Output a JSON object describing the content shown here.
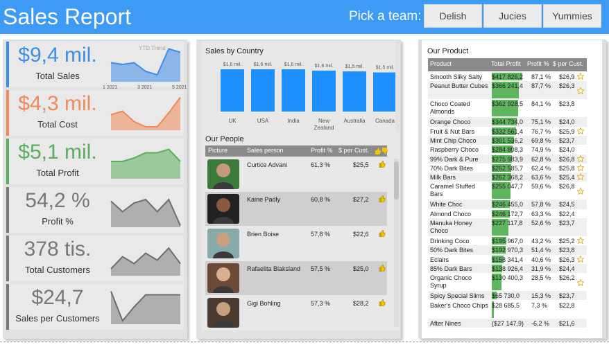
{
  "header": {
    "title": "Sales Report",
    "pick_label": "Pick a team:",
    "teams": [
      "Delish",
      "Jucies",
      "Yummies"
    ]
  },
  "kpis": [
    {
      "value": "$9,4 mil.",
      "label": "Total Sales",
      "color": "#3d8ee8",
      "trend_label": "YTD Trend",
      "axis": [
        "1 2021",
        "3 2021",
        "5 2021"
      ],
      "trend": [
        0.55,
        0.5,
        0.55,
        0.3,
        0.2,
        0.95,
        0.85
      ]
    },
    {
      "value": "$4,3 mil.",
      "label": "Total Cost",
      "color": "#ef8a5a",
      "trend": [
        0.45,
        0.55,
        0.25,
        0.1,
        0.1,
        0.5,
        0.95
      ]
    },
    {
      "value": "$5,1 mil.",
      "label": "Total Profit",
      "color": "#5cae5c",
      "trend": [
        0.5,
        0.5,
        0.6,
        0.75,
        0.75,
        0.85,
        0.5
      ]
    },
    {
      "value": "54,2 %",
      "label": "Profit %",
      "color": "#777777",
      "trend": [
        0.75,
        0.45,
        0.7,
        0.8,
        0.45,
        0.8,
        0.05
      ]
    },
    {
      "value": "378 tis.",
      "label": "Total Customers",
      "color": "#777777",
      "trend": [
        0.2,
        0.55,
        0.35,
        0.65,
        0.45,
        0.8,
        0.35
      ]
    },
    {
      "value": "$24,7",
      "label": "Sales per Customers",
      "color": "#777777",
      "trend": [
        0.95,
        0.1,
        0.5,
        0.85,
        0.85,
        0.85,
        0.85
      ]
    }
  ],
  "sales_by_country": {
    "title": "Sales by Country",
    "chart_data": {
      "type": "bar",
      "categories": [
        "UK",
        "USA",
        "India",
        "New Zealand",
        "Australia",
        "Canada"
      ],
      "value_labels": [
        "$1,6 mil.",
        "$1,6 mil.",
        "$1,6 mil.",
        "$1,6 mil.",
        "$1,5 mil.",
        "$1,5 mil."
      ],
      "values": [
        1.6,
        1.6,
        1.6,
        1.55,
        1.52,
        1.48
      ],
      "ylim": [
        0,
        1.7
      ]
    }
  },
  "our_people": {
    "title": "Our People",
    "columns": [
      "Picture",
      "Sales person",
      "Profit %",
      "$ per Cust."
    ],
    "rows": [
      {
        "name": "Curtice Advani",
        "profit": "61,3 %",
        "per_cust": "$25,5"
      },
      {
        "name": "Kaine Padly",
        "profit": "60,8 %",
        "per_cust": "$27,2"
      },
      {
        "name": "Brien Boise",
        "profit": "57,8 %",
        "per_cust": "$22,6"
      },
      {
        "name": "Rafaelita Blaksland",
        "profit": "57,5 %",
        "per_cust": "$25,0"
      },
      {
        "name": "Gigi Bohling",
        "profit": "57,3 %",
        "per_cust": "$28,2"
      }
    ]
  },
  "our_product": {
    "title": "Our Product",
    "columns": [
      "Product",
      "Total Profit",
      "Profit %",
      "$ per Cust."
    ],
    "rows": [
      {
        "name": "Smooth Sliky Salty",
        "profit": "$417 826,2",
        "bar": 1.0,
        "pct": "87,1 %",
        "cust": "$26,9",
        "star": true,
        "lines": 1
      },
      {
        "name": "Peanut Butter Cubes",
        "profit": "$366 241,4",
        "bar": 0.877,
        "pct": "87,7 %",
        "cust": "$26,3",
        "star": true,
        "lines": 2
      },
      {
        "name": "Choco Coated Almonds",
        "profit": "$362 928,5",
        "bar": 0.869,
        "pct": "84,1 %",
        "cust": "$23,8",
        "star": false,
        "lines": 2
      },
      {
        "name": "Orange Choco",
        "profit": "$344 734,0",
        "bar": 0.825,
        "pct": "75,1 %",
        "cust": "$24,0",
        "star": false,
        "lines": 1
      },
      {
        "name": "Fruit & Nut Bars",
        "profit": "$332 561,4",
        "bar": 0.796,
        "pct": "76,7 %",
        "cust": "$25,9",
        "star": true,
        "lines": 1
      },
      {
        "name": "Mint Chip Choco",
        "profit": "$301 536,2",
        "bar": 0.722,
        "pct": "69,8 %",
        "cust": "$23,7",
        "star": false,
        "lines": 1
      },
      {
        "name": "Raspberry Choco",
        "profit": "$284 808,3",
        "bar": 0.682,
        "pct": "74,9 %",
        "cust": "$24,0",
        "star": false,
        "lines": 1
      },
      {
        "name": "99% Dark & Pure",
        "profit": "$275 983,9",
        "bar": 0.66,
        "pct": "62,8 %",
        "cust": "$26,8",
        "star": true,
        "lines": 1
      },
      {
        "name": "70% Dark Bites",
        "profit": "$262 585,7",
        "bar": 0.628,
        "pct": "62,4 %",
        "cust": "$25,8",
        "star": true,
        "lines": 1
      },
      {
        "name": "Milk Bars",
        "profit": "$262 368,2",
        "bar": 0.628,
        "pct": "63,6 %",
        "cust": "$25,4",
        "star": true,
        "lines": 1
      },
      {
        "name": "Caramel Stuffed Bars",
        "profit": "$255 047,7",
        "bar": 0.61,
        "pct": "59,6 %",
        "cust": "$26,8",
        "star": true,
        "lines": 2
      },
      {
        "name": "White Choc",
        "profit": "$246 455,0",
        "bar": 0.59,
        "pct": "57,8 %",
        "cust": "$24,5",
        "star": false,
        "lines": 1
      },
      {
        "name": "Almond Choco",
        "profit": "$246 172,7",
        "bar": 0.589,
        "pct": "63,3 %",
        "cust": "$22,4",
        "star": false,
        "lines": 1
      },
      {
        "name": "Manuka Honey Choco",
        "profit": "$227 117,8",
        "bar": 0.544,
        "pct": "52,6 %",
        "cust": "$23,7",
        "star": false,
        "lines": 2
      },
      {
        "name": "Drinking Coco",
        "profit": "$195 967,0",
        "bar": 0.469,
        "pct": "43,2 %",
        "cust": "$25,2",
        "star": true,
        "lines": 1
      },
      {
        "name": "50% Dark Bites",
        "profit": "$192 970,3",
        "bar": 0.462,
        "pct": "51,4 %",
        "cust": "$23,8",
        "star": false,
        "lines": 1
      },
      {
        "name": "Eclairs",
        "profit": "$158 341,4",
        "bar": 0.379,
        "pct": "40,6 %",
        "cust": "$26,3",
        "star": true,
        "lines": 1
      },
      {
        "name": "85% Dark Bars",
        "profit": "$138 926,4",
        "bar": 0.333,
        "pct": "31,9 %",
        "cust": "$24,4",
        "star": false,
        "lines": 1
      },
      {
        "name": "Organic Choco Syrup",
        "profit": "$130 400,3",
        "bar": 0.312,
        "pct": "28,5 %",
        "cust": "$26,2",
        "star": true,
        "lines": 2
      },
      {
        "name": "Spicy Special Slims",
        "profit": "$65 730,0",
        "bar": 0.157,
        "pct": "15,3 %",
        "cust": "$23,7",
        "star": false,
        "lines": 1
      },
      {
        "name": "Baker's Choco Chips",
        "profit": "$28 685,5",
        "bar": 0.069,
        "pct": "7,3 %",
        "cust": "$22,8",
        "star": false,
        "lines": 2
      },
      {
        "name": "After Nines",
        "profit": "($27 147,9)",
        "bar": 0,
        "pct": "-6,2 %",
        "cust": "$21,6",
        "star": false,
        "lines": 1
      }
    ]
  }
}
